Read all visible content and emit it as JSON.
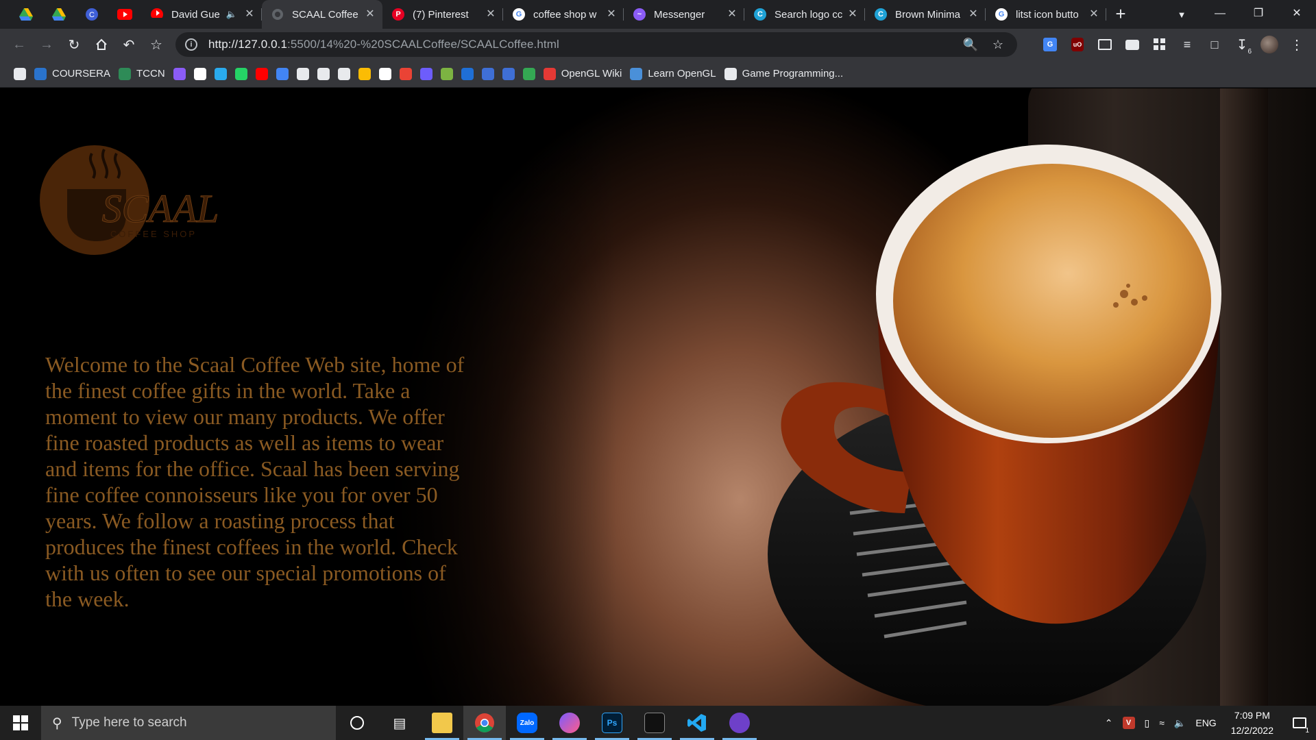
{
  "browser": {
    "pinned_tabs": [
      {
        "icon": "google-drive-icon"
      },
      {
        "icon": "google-drive-icon"
      },
      {
        "icon": "canva-icon"
      },
      {
        "icon": "youtube-icon"
      }
    ],
    "tabs": [
      {
        "title": "David Gue",
        "icon": "youtube-icon",
        "color": "#ff0000",
        "muted": true,
        "active": false
      },
      {
        "title": "SCAAL Coffee",
        "icon": "globe-icon",
        "color": "#5f6368",
        "active": true
      },
      {
        "title": "(7) Pinterest",
        "icon": "pinterest-icon",
        "color": "#e60023",
        "active": false
      },
      {
        "title": "coffee shop w",
        "icon": "google-icon",
        "color": "#ffffff",
        "active": false
      },
      {
        "title": "Messenger",
        "icon": "messenger-icon",
        "color": "#8b5cf6",
        "active": false
      },
      {
        "title": "Search logo cc",
        "icon": "canva-icon",
        "color": "#1fa2d6",
        "active": false
      },
      {
        "title": "Brown Minima",
        "icon": "canva-icon",
        "color": "#1fa2d6",
        "active": false
      },
      {
        "title": "litst icon butto",
        "icon": "google-icon",
        "color": "#ffffff",
        "active": false
      }
    ],
    "new_tab_label": "+",
    "url_host": "http://127.0.0.1",
    "url_path": ":5500/14%20-%20SCAALCoffee/SCAALCoffee.html",
    "download_badge": "6",
    "bookmarks": [
      {
        "label": "",
        "icon": "apps-grid-icon",
        "color": "#e8eaed"
      },
      {
        "label": "COURSERA",
        "icon": "coursera-icon",
        "color": "#2a73cc"
      },
      {
        "label": "TCCN",
        "icon": "plus-icon",
        "color": "#2e8b57"
      },
      {
        "label": "",
        "icon": "messenger-icon",
        "color": "#8b5cf6"
      },
      {
        "label": "",
        "icon": "bookmark-icon",
        "color": "#ffffff"
      },
      {
        "label": "",
        "icon": "telegram-icon",
        "color": "#2aabee"
      },
      {
        "label": "",
        "icon": "whatsapp-icon",
        "color": "#25d366"
      },
      {
        "label": "",
        "icon": "youtube-icon",
        "color": "#ff0000"
      },
      {
        "label": "",
        "icon": "translate-icon",
        "color": "#4285f4"
      },
      {
        "label": "",
        "icon": "pen-icon",
        "color": "#e8eaed"
      },
      {
        "label": "",
        "icon": "document-icon",
        "color": "#e8eaed"
      },
      {
        "label": "",
        "icon": "github-icon",
        "color": "#e8eaed"
      },
      {
        "label": "",
        "icon": "google-drive-icon",
        "color": "#fbbc04"
      },
      {
        "label": "",
        "icon": "google-icon",
        "color": "#ffffff"
      },
      {
        "label": "",
        "icon": "gmail-icon",
        "color": "#ea4335"
      },
      {
        "label": "",
        "icon": "globe-icon",
        "color": "#6d5dfc"
      },
      {
        "label": "",
        "icon": "chart-icon",
        "color": "#7cb342"
      },
      {
        "label": "",
        "icon": "paypal-icon",
        "color": "#1f6fd6"
      },
      {
        "label": "",
        "icon": "canva-icon",
        "color": "#3f6fd6"
      },
      {
        "label": "",
        "icon": "canva-icon",
        "color": "#3f6fd6"
      },
      {
        "label": "",
        "icon": "google-drive-icon",
        "color": "#34a853"
      },
      {
        "label": "OpenGL Wiki",
        "icon": "opengl-icon",
        "color": "#e53935"
      },
      {
        "label": "Learn OpenGL",
        "icon": "learnopengl-icon",
        "color": "#4a90d9"
      },
      {
        "label": "Game Programming...",
        "icon": "globe-icon",
        "color": "#e8eaed"
      }
    ]
  },
  "page": {
    "logo_main": "SCAAL",
    "logo_sub": "COFFEE SHOP",
    "welcome_text": "Welcome to the Scaal Coffee Web site, home of the finest coffee gifts in the world. Take a moment to view our many products. We offer fine roasted products as well as items to wear and items for the office. Scaal has been serving fine coffee connoisseurs like you for over 50 years. We follow a roasting process that produces the finest coffees in the world. Check with us often to see our special promotions of the week.",
    "text_color": "#8a5a22"
  },
  "taskbar": {
    "search_placeholder": "Type here to search",
    "apps": [
      {
        "name": "cortana-icon",
        "running": false
      },
      {
        "name": "task-view-icon",
        "running": false
      },
      {
        "name": "file-explorer-icon",
        "running": true,
        "label": ""
      },
      {
        "name": "chrome-icon",
        "running": true,
        "active": true
      },
      {
        "name": "zalo-icon",
        "running": true,
        "label": "Zalo"
      },
      {
        "name": "messenger-icon",
        "running": true
      },
      {
        "name": "photoshop-icon",
        "running": true,
        "label": "Ps"
      },
      {
        "name": "terminal-icon",
        "running": true
      },
      {
        "name": "vscode-icon",
        "running": true
      },
      {
        "name": "github-desktop-icon",
        "running": true
      }
    ],
    "language": "ENG",
    "time": "7:09 PM",
    "date": "12/2/2022",
    "notification_count": "1"
  }
}
